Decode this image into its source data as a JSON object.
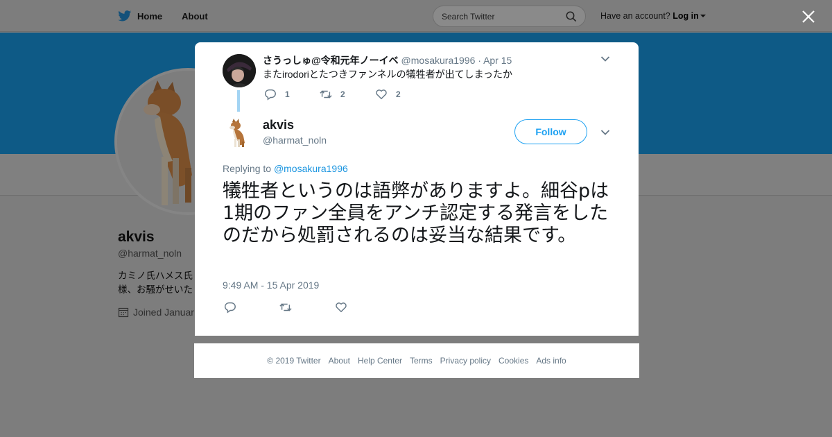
{
  "topnav": {
    "home_label": "Home",
    "about_label": "About",
    "search_placeholder": "Search Twitter",
    "account_prompt": "Have an account?",
    "login_label": "Log in"
  },
  "background_profile": {
    "name": "akvis",
    "handle": "@harmat_noln",
    "bio_line1": "カミノ氏ハメス氏",
    "bio_line2": "様、お騒がせいた",
    "joined": "Joined Januar"
  },
  "parent_tweet": {
    "name": "さうっしゅ@令和元年ノーイベ",
    "handle": "@mosakura1996",
    "separator": "·",
    "date": "Apr 15",
    "text": "またirodoriとたつきファンネルの犠牲者が出てしまったか",
    "reply_count": "1",
    "retweet_count": "2",
    "like_count": "2"
  },
  "main_tweet": {
    "name": "akvis",
    "handle": "@harmat_noln",
    "follow_label": "Follow",
    "replying_prefix": "Replying to",
    "replying_to": "@mosakura1996",
    "text": "犠牲者というのは語弊がありますよ。細谷pは1期のファン全員をアンチ認定する発言をしたのだから処罰されるのは妥当な結果です。",
    "timestamp": "9:49 AM - 15 Apr 2019"
  },
  "footer": {
    "copyright": "© 2019 Twitter",
    "about": "About",
    "help": "Help Center",
    "terms": "Terms",
    "privacy": "Privacy policy",
    "cookies": "Cookies",
    "ads": "Ads info"
  },
  "colors": {
    "accent": "#1da1f2",
    "link": "#1b95e0",
    "muted": "#657786",
    "overlay_bg": "#7d7d7d",
    "banner": "#0e5a86"
  }
}
